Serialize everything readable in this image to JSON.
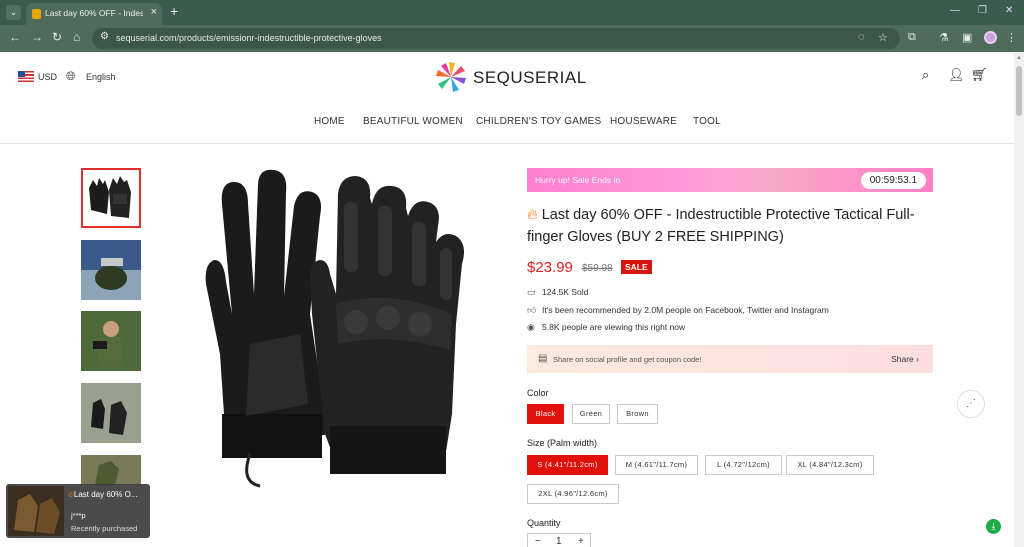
{
  "browser": {
    "tab_title": "Last day 60% OFF - Indestr",
    "url": "sequserial.com/products/emissionr-indestructible-protective-gloves"
  },
  "header": {
    "currency": "USD",
    "language": "English",
    "brand": "SEQUSERIAL"
  },
  "nav": {
    "items": [
      "HOME",
      "BEAUTIFUL WOMEN",
      "CHILDREN'S TOY GAMES",
      "HOUSEWARE",
      "TOOL"
    ]
  },
  "promo": {
    "hurry_text": "Hurry up! Sale Ends in",
    "timer": "00:59:53.1"
  },
  "product": {
    "title": "Last day 60% OFF - Indestructible Protective Tactical Full-finger Gloves (BUY 2 FREE SHIPPING)",
    "price": "$23.99",
    "old_price": "$59.98",
    "sale_badge": "SALE",
    "sold": "124.5K Sold",
    "recommended": "It's been recommended by 2.0M people on Facebook, Twitter and Instagram",
    "viewing": "5.8K people are viewing this right now"
  },
  "share_bar": {
    "text": "Share on social profile and get coupon code!",
    "button": "Share"
  },
  "color": {
    "label": "Color",
    "options": [
      "Black",
      "Green",
      "Brown"
    ],
    "selected": "Black"
  },
  "size": {
    "label": "Size (Palm width)",
    "options": [
      "S (4.41\"/11.2cm)",
      "M (4.61\"/11.7cm)",
      "L (4.72\"/12cm)",
      "XL (4.84\"/12.3cm)",
      "2XL (4.96\"/12.6cm)"
    ],
    "selected": "S (4.41\"/11.2cm)"
  },
  "quantity": {
    "label": "Quantity",
    "value": "1",
    "minus": "−",
    "plus": "+"
  },
  "toast": {
    "title": "Last day 60% O...",
    "buyer": "j***p",
    "status": "Recently purchased"
  },
  "colors": {
    "accent_red": "#e0100a",
    "banner_pink": "#ff80c8",
    "browser_green": "#4e6b5c"
  }
}
